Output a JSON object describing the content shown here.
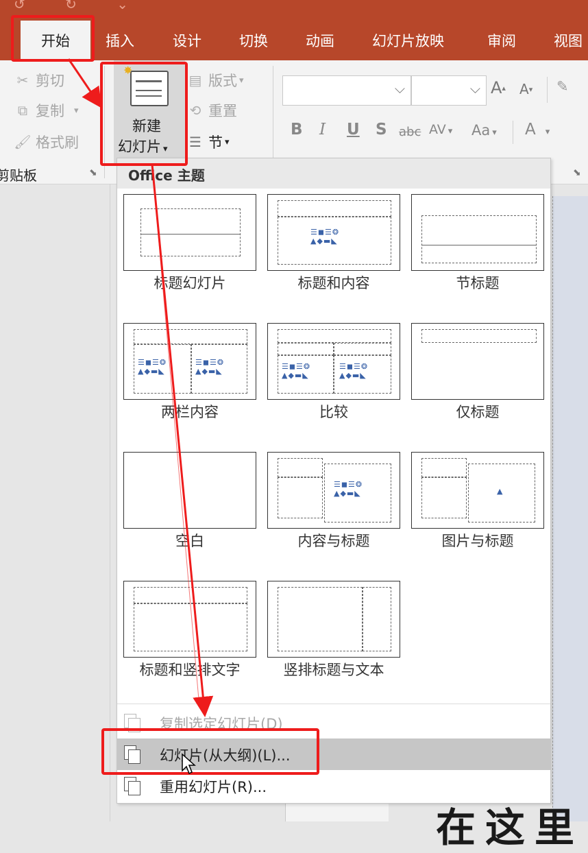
{
  "ribbon_tabs": [
    {
      "label": "开始",
      "active": true
    },
    {
      "label": "插入"
    },
    {
      "label": "设计"
    },
    {
      "label": "切换"
    },
    {
      "label": "动画"
    },
    {
      "label": "幻灯片放映"
    },
    {
      "label": "审阅"
    },
    {
      "label": "视图"
    }
  ],
  "clipboard": {
    "cut": "剪切",
    "copy": "复制",
    "format_painter": "格式刷",
    "group_label": "剪贴板"
  },
  "slides": {
    "new_slide_line1": "新建",
    "new_slide_line2": "幻灯片",
    "layout": "版式",
    "reset": "重置",
    "section": "节"
  },
  "font": {
    "bold": "B",
    "italic": "I",
    "underline": "U",
    "shadow": "S",
    "strikethrough": "abc",
    "char_spacing": "AV",
    "change_case": "Aa",
    "font_color": "A",
    "grow": "A",
    "shrink": "A"
  },
  "gallery": {
    "header": "Office 主题",
    "layouts": [
      "标题幻灯片",
      "标题和内容",
      "节标题",
      "两栏内容",
      "比较",
      "仅标题",
      "空白",
      "内容与标题",
      "图片与标题",
      "标题和竖排文字",
      "竖排标题与文本"
    ]
  },
  "menu": {
    "duplicate": "复制选定幻灯片(D)",
    "from_outline": "幻灯片(从大纲)(L)...",
    "reuse": "重用幻灯片(R)..."
  },
  "slide_text": "在这里",
  "colors": {
    "ribbon_accent": "#b7472a",
    "annotation": "#ee1c1c",
    "hover_row": "#c6c6c6"
  }
}
